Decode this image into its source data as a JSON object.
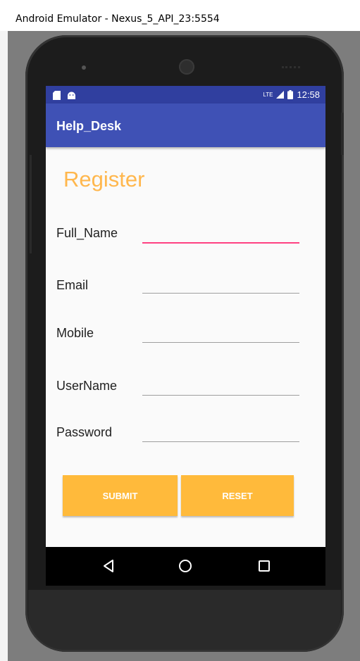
{
  "window": {
    "title": "Android Emulator - Nexus_5_API_23:5554"
  },
  "status_bar": {
    "left_icons": [
      "sd-card-icon",
      "android-icon"
    ],
    "network": "LTE",
    "time": "12:58"
  },
  "app_bar": {
    "title": "Help_Desk"
  },
  "form": {
    "heading": "Register",
    "fields": [
      {
        "label": "Full_Name",
        "value": "",
        "focused": true
      },
      {
        "label": "Email",
        "value": ""
      },
      {
        "label": "Mobile",
        "value": ""
      },
      {
        "label": "UserName",
        "value": ""
      },
      {
        "label": "Password",
        "value": ""
      }
    ]
  },
  "buttons": {
    "submit": "SUBMIT",
    "reset": "RESET"
  },
  "nav_bar": {
    "icons": [
      "back-icon",
      "home-icon",
      "recents-icon"
    ]
  },
  "colors": {
    "primary": "#3f51b5",
    "primary_dark": "#303f9f",
    "accent": "#ff4081",
    "heading": "#ffb74d",
    "button": "#ffba3b"
  }
}
